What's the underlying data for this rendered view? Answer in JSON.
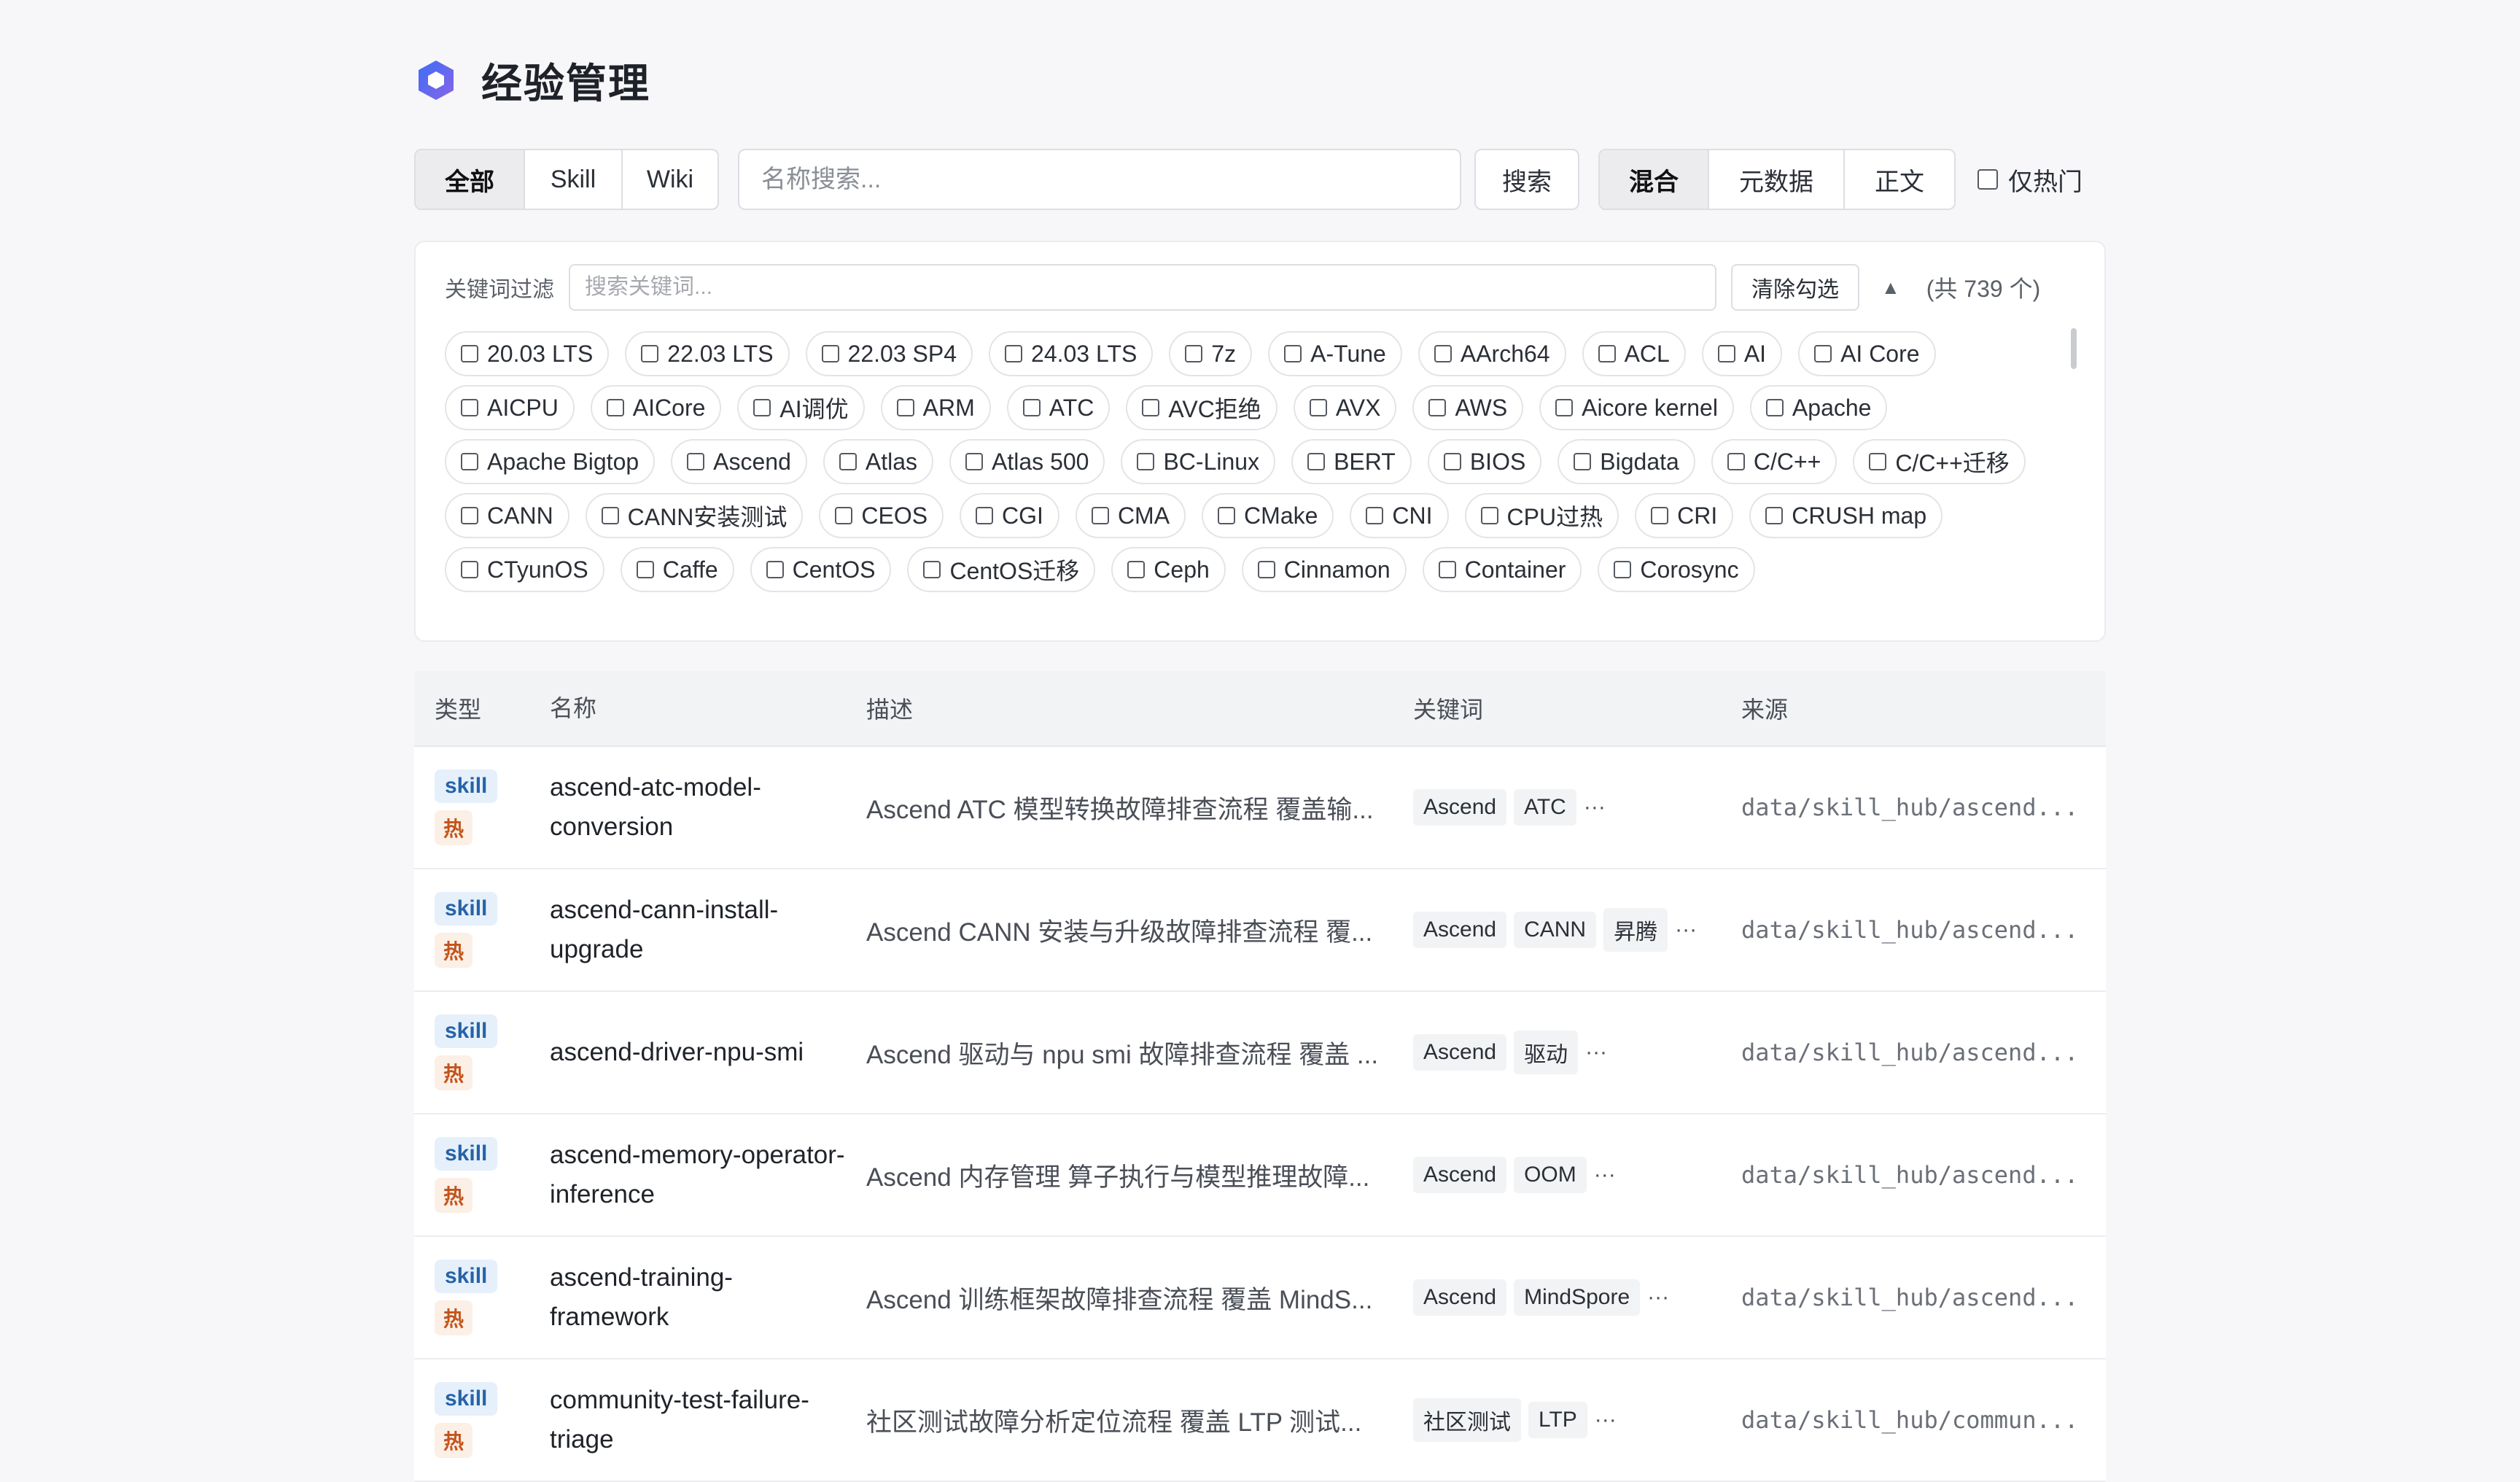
{
  "header": {
    "title": "经验管理",
    "logo_icon": "hexagon-logo-icon"
  },
  "toolbar": {
    "type_tabs": [
      {
        "label": "全部",
        "active": true
      },
      {
        "label": "Skill",
        "active": false
      },
      {
        "label": "Wiki",
        "active": false
      }
    ],
    "search_placeholder": "名称搜索...",
    "search_button": "搜索",
    "mode_tabs": [
      {
        "label": "混合",
        "active": true
      },
      {
        "label": "元数据",
        "active": false
      },
      {
        "label": "正文",
        "active": false
      }
    ],
    "hot_only_label": "仅热门"
  },
  "keyword_filter": {
    "label": "关键词过滤",
    "placeholder": "搜索关键词...",
    "clear_button": "清除勾选",
    "collapse_icon": "▲",
    "total": "(共 739 个)",
    "tags": [
      "20.03 LTS",
      "22.03 LTS",
      "22.03 SP4",
      "24.03 LTS",
      "7z",
      "A-Tune",
      "AArch64",
      "ACL",
      "AI",
      "AI Core",
      "AICPU",
      "AICore",
      "AI调优",
      "ARM",
      "ATC",
      "AVC拒绝",
      "AVX",
      "AWS",
      "Aicore kernel",
      "Apache",
      "Apache Bigtop",
      "Ascend",
      "Atlas",
      "Atlas 500",
      "BC-Linux",
      "BERT",
      "BIOS",
      "Bigdata",
      "C/C++",
      "C/C++迁移",
      "CANN",
      "CANN安装测试",
      "CEOS",
      "CGI",
      "CMA",
      "CMake",
      "CNI",
      "CPU过热",
      "CRI",
      "CRUSH map",
      "CTyunOS",
      "Caffe",
      "CentOS",
      "CentOS迁移",
      "Ceph",
      "Cinnamon",
      "Container",
      "Corosync"
    ]
  },
  "table": {
    "headers": {
      "type": "类型",
      "name": "名称",
      "desc": "描述",
      "keywords": "关键词",
      "source": "来源"
    },
    "rows": [
      {
        "type": "skill",
        "hot": "热",
        "name": "ascend-atc-model-conversion",
        "desc": "Ascend ATC 模型转换故障排查流程 覆盖输...",
        "keywords": [
          "Ascend",
          "ATC"
        ],
        "more": "···",
        "source": "data/skill_hub/ascend..."
      },
      {
        "type": "skill",
        "hot": "热",
        "name": "ascend-cann-install-upgrade",
        "desc": "Ascend CANN 安装与升级故障排查流程 覆...",
        "keywords": [
          "Ascend",
          "CANN",
          "昇腾"
        ],
        "more": "···",
        "source": "data/skill_hub/ascend..."
      },
      {
        "type": "skill",
        "hot": "热",
        "name": "ascend-driver-npu-smi",
        "desc": "Ascend 驱动与 npu smi 故障排查流程 覆盖 ...",
        "keywords": [
          "Ascend",
          "驱动"
        ],
        "more": "···",
        "source": "data/skill_hub/ascend..."
      },
      {
        "type": "skill",
        "hot": "热",
        "name": "ascend-memory-operator-inference",
        "desc": "Ascend 内存管理 算子执行与模型推理故障...",
        "keywords": [
          "Ascend",
          "OOM"
        ],
        "more": "···",
        "source": "data/skill_hub/ascend..."
      },
      {
        "type": "skill",
        "hot": "热",
        "name": "ascend-training-framework",
        "desc": "Ascend 训练框架故障排查流程 覆盖 MindS...",
        "keywords": [
          "Ascend",
          "MindSpore"
        ],
        "more": "···",
        "source": "data/skill_hub/ascend..."
      },
      {
        "type": "skill",
        "hot": "热",
        "name": "community-test-failure-triage",
        "desc": "社区测试故障分析定位流程 覆盖 LTP 测试...",
        "keywords": [
          "社区测试",
          "LTP"
        ],
        "more": "···",
        "source": "data/skill_hub/commun..."
      }
    ]
  }
}
